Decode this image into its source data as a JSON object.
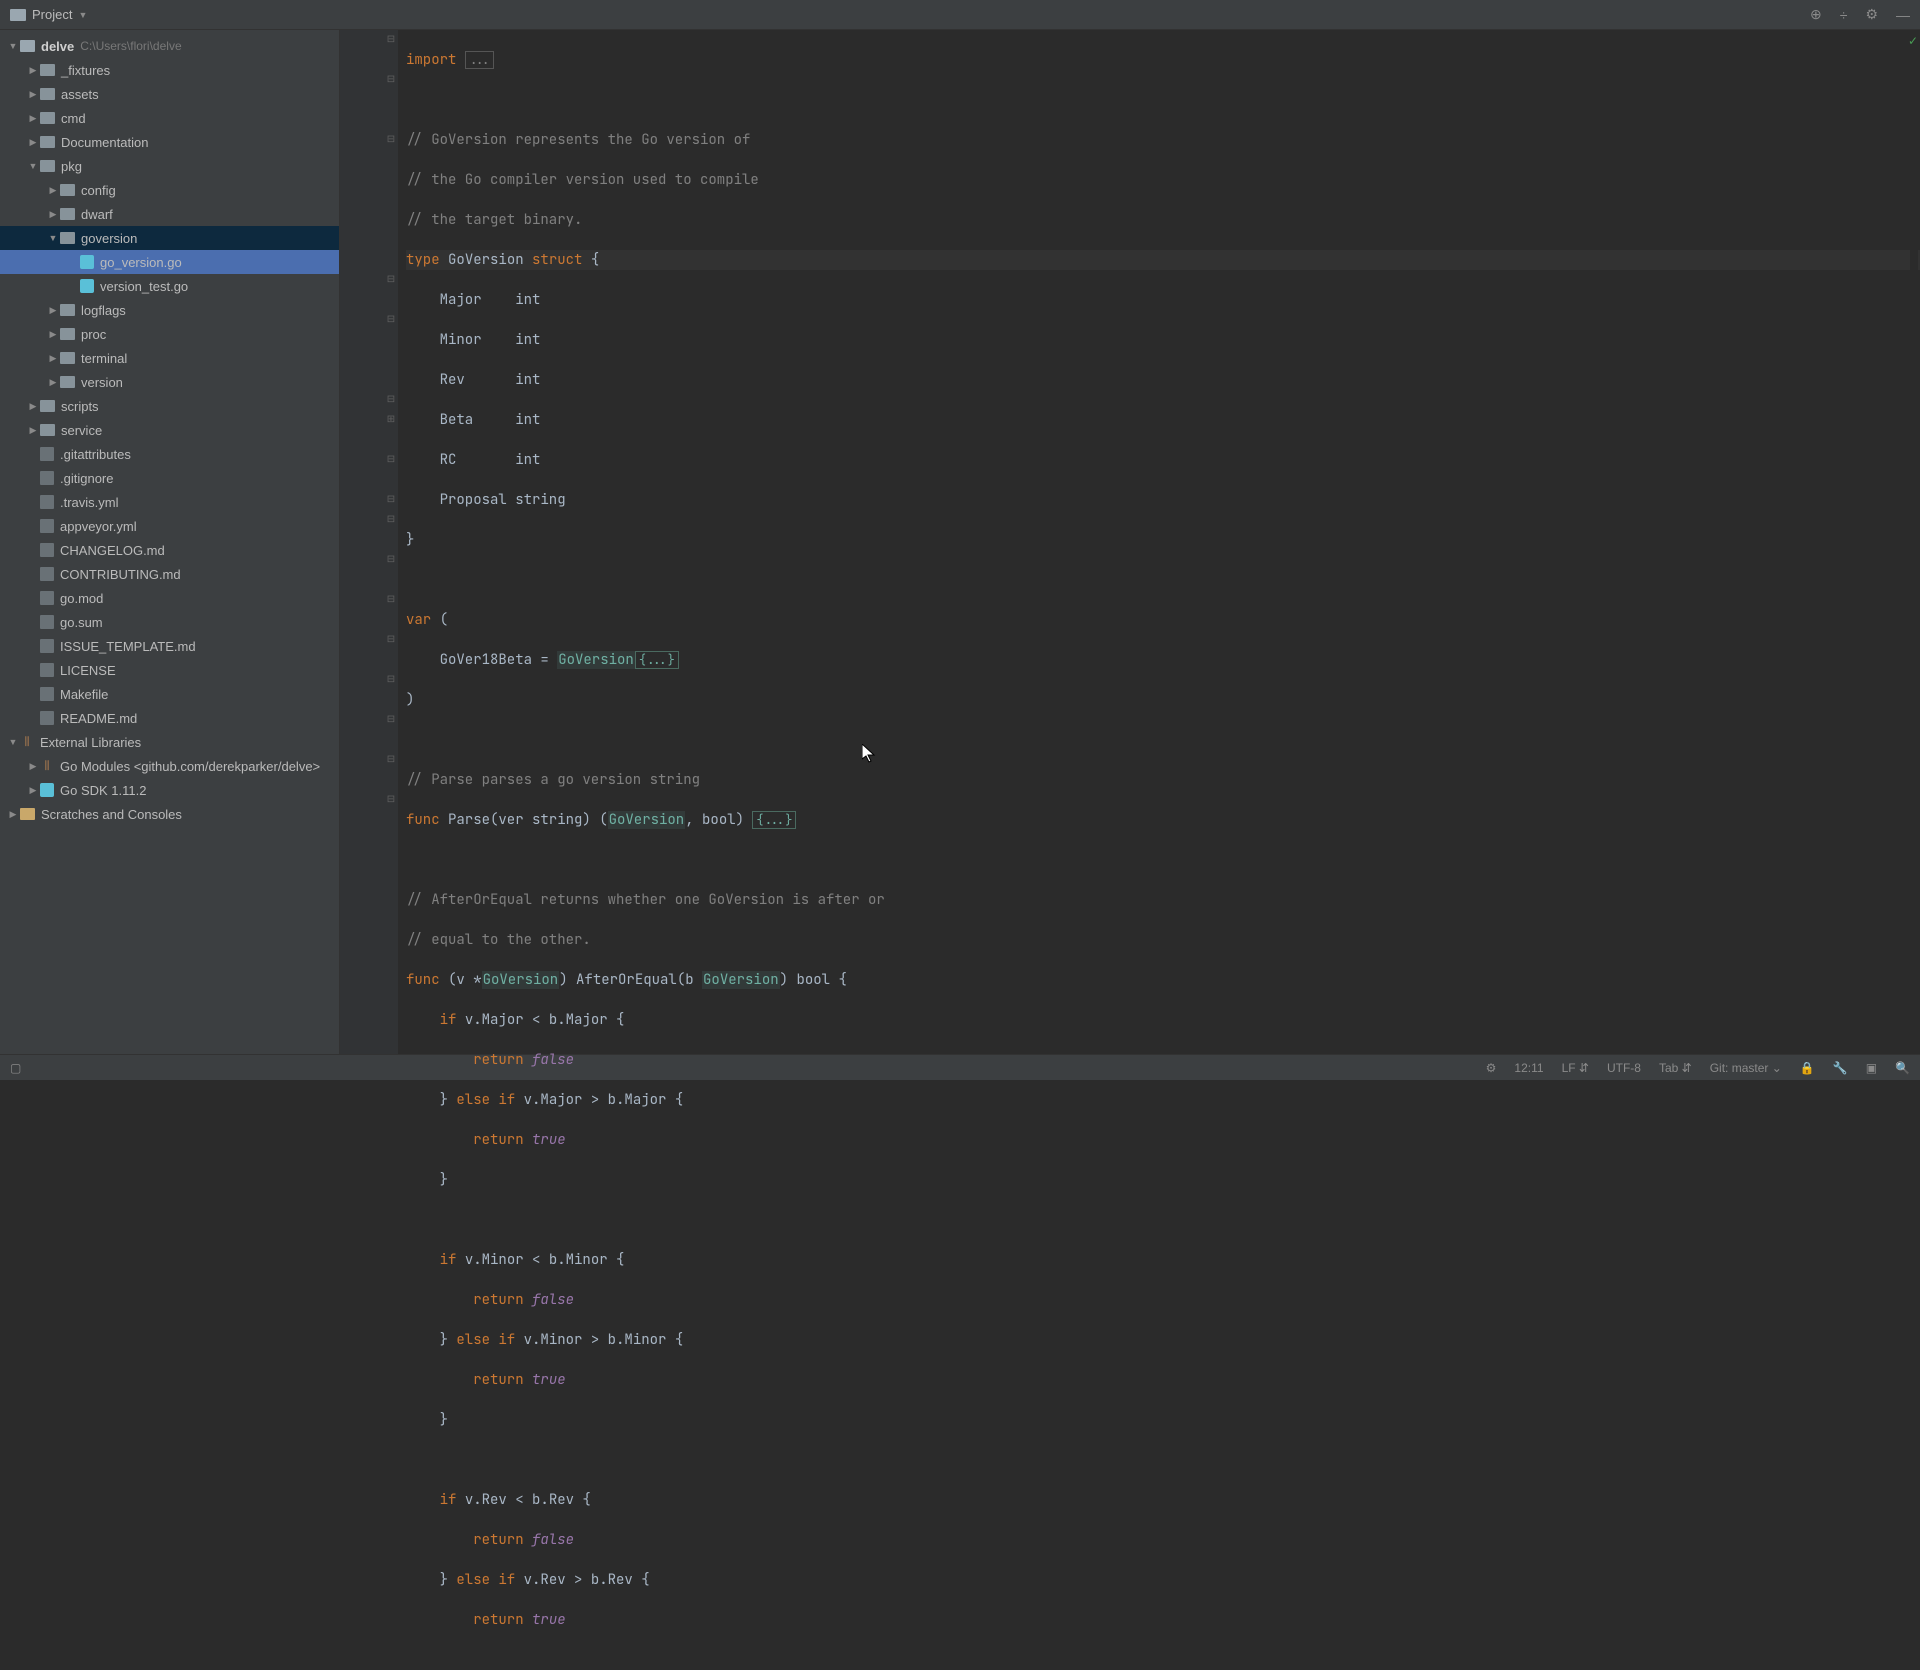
{
  "toolbar": {
    "project_label": "Project"
  },
  "tree": {
    "root_name": "delve",
    "root_path": "C:\\Users\\flori\\delve",
    "items": [
      {
        "label": "_fixtures",
        "depth": 1,
        "type": "folder",
        "expanded": false
      },
      {
        "label": "assets",
        "depth": 1,
        "type": "folder",
        "expanded": false
      },
      {
        "label": "cmd",
        "depth": 1,
        "type": "folder",
        "expanded": false
      },
      {
        "label": "Documentation",
        "depth": 1,
        "type": "folder",
        "expanded": false
      },
      {
        "label": "pkg",
        "depth": 1,
        "type": "folder",
        "expanded": true
      },
      {
        "label": "config",
        "depth": 2,
        "type": "folder",
        "expanded": false
      },
      {
        "label": "dwarf",
        "depth": 2,
        "type": "folder",
        "expanded": false
      },
      {
        "label": "goversion",
        "depth": 2,
        "type": "folder",
        "expanded": true,
        "cursor": true
      },
      {
        "label": "go_version.go",
        "depth": 3,
        "type": "gofile",
        "selected": true
      },
      {
        "label": "version_test.go",
        "depth": 3,
        "type": "gofile"
      },
      {
        "label": "logflags",
        "depth": 2,
        "type": "folder",
        "expanded": false
      },
      {
        "label": "proc",
        "depth": 2,
        "type": "folder",
        "expanded": false
      },
      {
        "label": "terminal",
        "depth": 2,
        "type": "folder",
        "expanded": false
      },
      {
        "label": "version",
        "depth": 2,
        "type": "folder",
        "expanded": false
      },
      {
        "label": "scripts",
        "depth": 1,
        "type": "folder",
        "expanded": false
      },
      {
        "label": "service",
        "depth": 1,
        "type": "folder",
        "expanded": false
      },
      {
        "label": ".gitattributes",
        "depth": 1,
        "type": "file"
      },
      {
        "label": ".gitignore",
        "depth": 1,
        "type": "file"
      },
      {
        "label": ".travis.yml",
        "depth": 1,
        "type": "file"
      },
      {
        "label": "appveyor.yml",
        "depth": 1,
        "type": "file"
      },
      {
        "label": "CHANGELOG.md",
        "depth": 1,
        "type": "file"
      },
      {
        "label": "CONTRIBUTING.md",
        "depth": 1,
        "type": "file"
      },
      {
        "label": "go.mod",
        "depth": 1,
        "type": "file"
      },
      {
        "label": "go.sum",
        "depth": 1,
        "type": "file"
      },
      {
        "label": "ISSUE_TEMPLATE.md",
        "depth": 1,
        "type": "file"
      },
      {
        "label": "LICENSE",
        "depth": 1,
        "type": "file"
      },
      {
        "label": "Makefile",
        "depth": 1,
        "type": "file"
      },
      {
        "label": "README.md",
        "depth": 1,
        "type": "file"
      }
    ],
    "external_libs": "External Libraries",
    "go_modules": "Go Modules <github.com/derekparker/delve>",
    "go_sdk": "Go SDK 1.11.2",
    "scratches": "Scratches and Consoles"
  },
  "code": {
    "l1_import": "import",
    "l1_rest": " ",
    "l1_fold": "...",
    "l3": "// GoVersion represents the Go version of",
    "l4": "// the Go compiler version used to compile",
    "l5": "// the target binary.",
    "l6_type": "type",
    "l6_name": "GoVersion",
    "l6_struct": "struct",
    "l6_brace": " {",
    "l7": "    Major    int",
    "l8": "    Minor    int",
    "l9": "    Rev      int",
    "l10": "    Beta     int",
    "l11": "    RC       int",
    "l12": "    Proposal string",
    "l13": "}",
    "l15_var": "var",
    "l15_rest": " (",
    "l16_a": "    GoVer18Beta = ",
    "l16_b": "GoVersion",
    "l16_c": "{...}",
    "l17": ")",
    "l19": "// Parse parses a go version string",
    "l20_func": "func",
    "l20_a": " Parse(ver string) (",
    "l20_b": "GoVersion",
    "l20_c": ", bool) ",
    "l20_fold": "{...}",
    "l22": "// AfterOrEqual returns whether one GoVersion is after or",
    "l23": "// equal to the other.",
    "l24_func": "func",
    "l24_a": " (v *",
    "l24_b": "GoVersion",
    "l24_c": ") AfterOrEqual(b ",
    "l24_d": "GoVersion",
    "l24_e": ") bool {",
    "l25_if": "if",
    "l25_a": " v.Major < b.Major {",
    "l26_ret": "return",
    "l26_val": "false",
    "l27_a": "    } ",
    "l27_else": "else if",
    "l27_b": " v.Major > b.Major {",
    "l28_ret": "return",
    "l28_val": "true",
    "l29": "    }",
    "l31_if": "if",
    "l31_a": " v.Minor < b.Minor {",
    "l32_ret": "return",
    "l32_val": "false",
    "l33_a": "    } ",
    "l33_else": "else if",
    "l33_b": " v.Minor > b.Minor {",
    "l34_ret": "return",
    "l34_val": "true",
    "l35": "    }",
    "l37_if": "if",
    "l37_a": " v.Rev < b.Rev {",
    "l38_ret": "return",
    "l38_val": "false",
    "l39_a": "    } ",
    "l39_else": "else if",
    "l39_b": " v.Rev > b.Rev {",
    "l40_ret": "return",
    "l40_val": "true"
  },
  "status": {
    "pos": "12:11",
    "line_sep": "LF",
    "encoding": "UTF-8",
    "indent": "Tab",
    "git": "Git: master"
  }
}
